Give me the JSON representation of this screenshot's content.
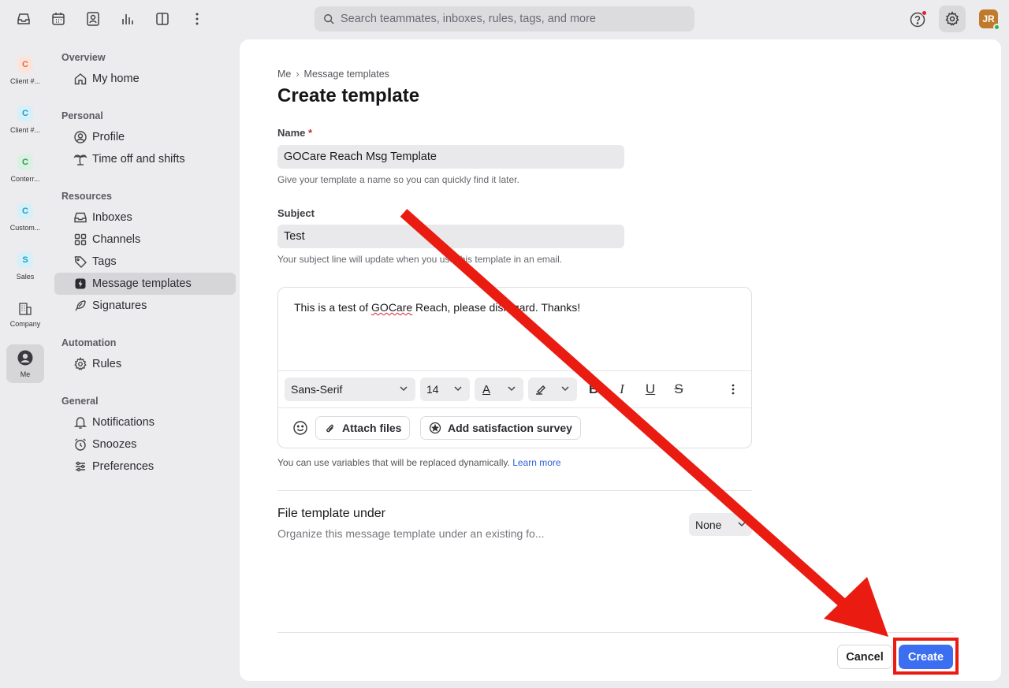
{
  "topbar": {
    "icons": [
      "inbox-icon",
      "calendar-icon",
      "contacts-icon",
      "analytics-icon",
      "split-view-icon",
      "more-vertical-icon"
    ],
    "search_placeholder": "Search teammates, inboxes, rules, tags, and more",
    "avatar_initials": "JR"
  },
  "rail": {
    "items": [
      {
        "badge": "C",
        "label": "Client #...",
        "color": "#e8663d",
        "bg": "#fde4da"
      },
      {
        "badge": "C",
        "label": "Client #...",
        "color": "#1d9fc4",
        "bg": "#d5f0f8"
      },
      {
        "badge": "C",
        "label": "Conterr...",
        "color": "#2f9a52",
        "bg": "#d9f1e0"
      },
      {
        "badge": "C",
        "label": "Custom...",
        "color": "#1d9fc4",
        "bg": "#d5f0f8"
      },
      {
        "badge": "S",
        "label": "Sales",
        "color": "#1d9fc4",
        "bg": "#d5f0f8"
      }
    ],
    "company_label": "Company",
    "me_label": "Me"
  },
  "sidebar": {
    "overview_title": "Overview",
    "my_home": "My home",
    "personal_title": "Personal",
    "profile": "Profile",
    "time_off": "Time off and shifts",
    "resources_title": "Resources",
    "inboxes": "Inboxes",
    "channels": "Channels",
    "tags": "Tags",
    "message_templates": "Message templates",
    "signatures": "Signatures",
    "automation_title": "Automation",
    "rules": "Rules",
    "general_title": "General",
    "notifications": "Notifications",
    "snoozes": "Snoozes",
    "preferences": "Preferences"
  },
  "main": {
    "breadcrumb": [
      "Me",
      "Message templates"
    ],
    "title": "Create template",
    "name_label": "Name",
    "name_required": "*",
    "name_value": "GOCare Reach Msg Template",
    "name_hint": "Give your template a name so you can quickly find it later.",
    "subject_label": "Subject",
    "subject_value": "Test",
    "subject_hint": "Your subject line will update when you use this template in an email.",
    "body_before": "This is a test of ",
    "body_misspelled": "GOCare",
    "body_after": " Reach, please disregard. Thanks!",
    "font_family": "Sans-Serif",
    "font_size": "14",
    "text_color_glyph": "A",
    "attach_files": "Attach files",
    "add_survey": "Add satisfaction survey",
    "variables_hint": "You can use variables that will be replaced dynamically.",
    "learn_more": "Learn more",
    "file_under_title": "File template under",
    "file_under_sub": "Organize this message template under an existing fo...",
    "file_under_value": "None",
    "cancel": "Cancel",
    "create": "Create"
  },
  "colors": {
    "accent": "#3b6ef0",
    "annotation": "#ea1c12"
  }
}
